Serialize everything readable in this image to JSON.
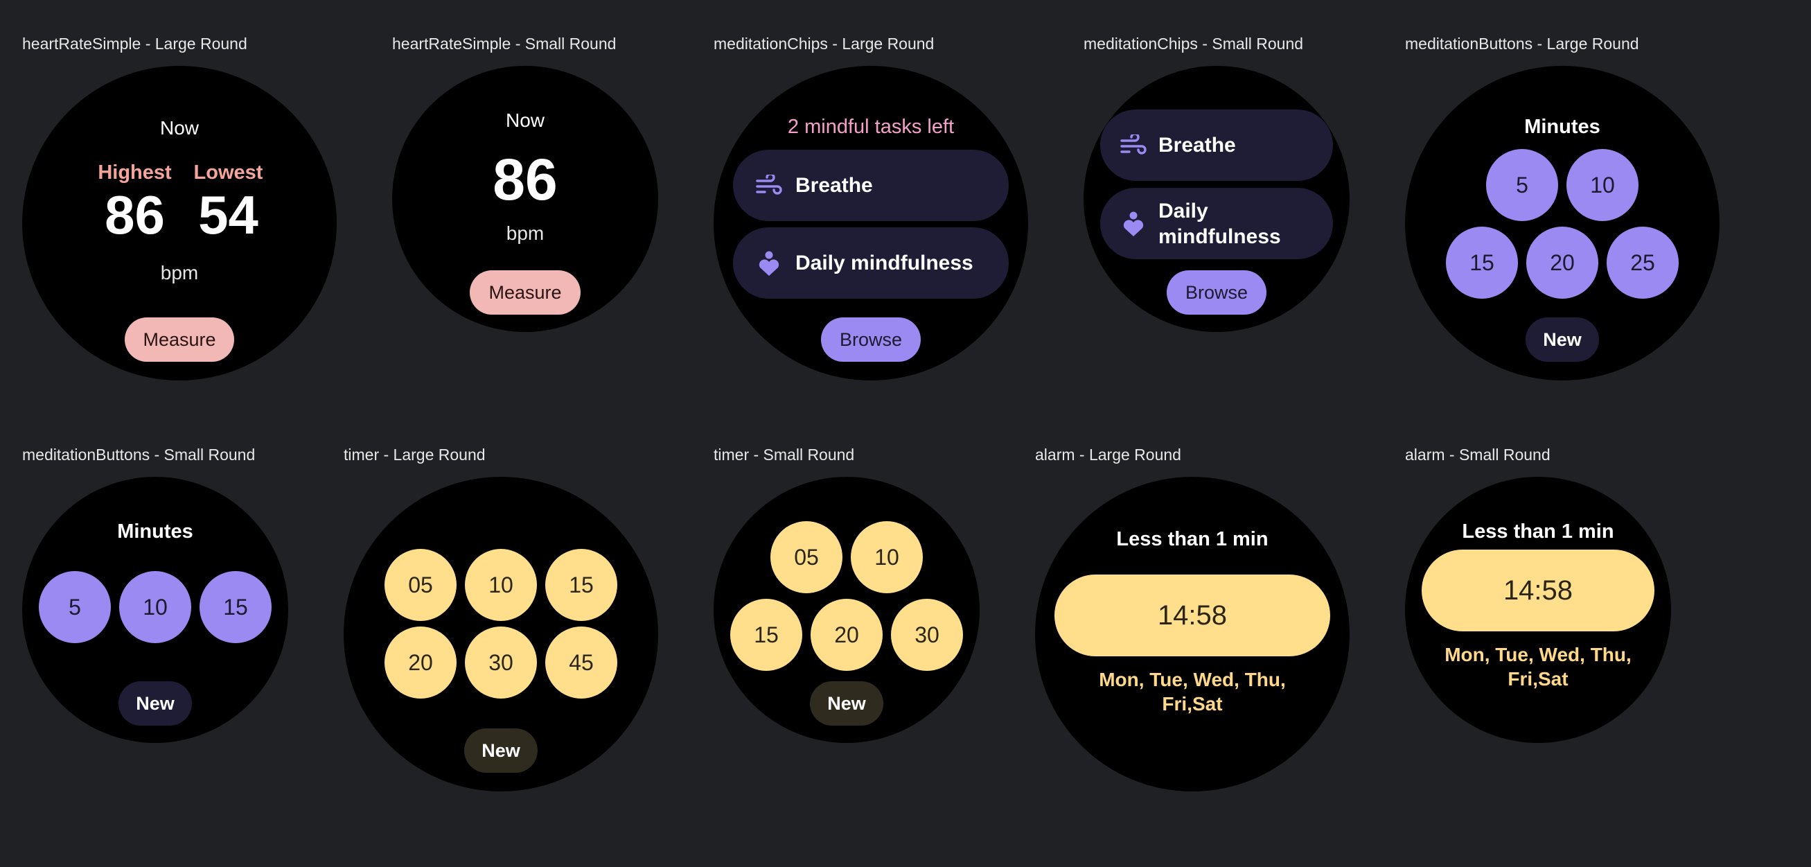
{
  "colors": {
    "background": "#202125",
    "watch_face": "#000000",
    "heart_pink": "#f2b8b5",
    "heart_label": "#f4a49b",
    "purple": "#9b8af2",
    "purple_text": "#f4a0c8",
    "chip_bg": "#1f1c35",
    "yellow": "#ffdf8b",
    "alarm_days": "#ffd88a",
    "new_dark_purple": "#1f1c35",
    "new_dark_olive": "#2f2b1f"
  },
  "previews": {
    "heart_large": {
      "label": "heartRateSimple - Large Round",
      "now": "Now",
      "highest_label": "Highest",
      "lowest_label": "Lowest",
      "highest_value": "86",
      "lowest_value": "54",
      "unit": "bpm",
      "button": "Measure"
    },
    "heart_small": {
      "label": "heartRateSimple - Small Round",
      "now": "Now",
      "value": "86",
      "unit": "bpm",
      "button": "Measure"
    },
    "chips_large": {
      "label": "meditationChips - Large Round",
      "tasks_left": "2 mindful tasks left",
      "chip_breathe": "Breathe",
      "chip_daily": "Daily mindfulness",
      "button": "Browse",
      "icons": [
        "wind-icon",
        "meditation-person-icon"
      ]
    },
    "chips_small": {
      "label": "meditationChips - Small Round",
      "chip_breathe": "Breathe",
      "chip_daily_line1": "Daily",
      "chip_daily_line2": "mindfulness",
      "button": "Browse"
    },
    "buttons_large": {
      "label": "meditationButtons - Large Round",
      "title": "Minutes",
      "values": [
        "5",
        "10",
        "15",
        "20",
        "25"
      ],
      "button": "New"
    },
    "buttons_small": {
      "label": "meditationButtons - Small Round",
      "title": "Minutes",
      "values": [
        "5",
        "10",
        "15"
      ],
      "button": "New"
    },
    "timer_large": {
      "label": "timer - Large Round",
      "values": [
        "05",
        "10",
        "15",
        "20",
        "30",
        "45"
      ],
      "button": "New"
    },
    "timer_small": {
      "label": "timer - Small Round",
      "values": [
        "05",
        "10",
        "15",
        "20",
        "30"
      ],
      "button": "New"
    },
    "alarm_large": {
      "label": "alarm - Large Round",
      "title": "Less than 1 min",
      "time": "14:58",
      "days_line1": "Mon, Tue, Wed, Thu,",
      "days_line2": "Fri,Sat"
    },
    "alarm_small": {
      "label": "alarm - Small Round",
      "title": "Less than 1 min",
      "time": "14:58",
      "days_line1": "Mon, Tue, Wed, Thu,",
      "days_line2": "Fri,Sat"
    }
  }
}
